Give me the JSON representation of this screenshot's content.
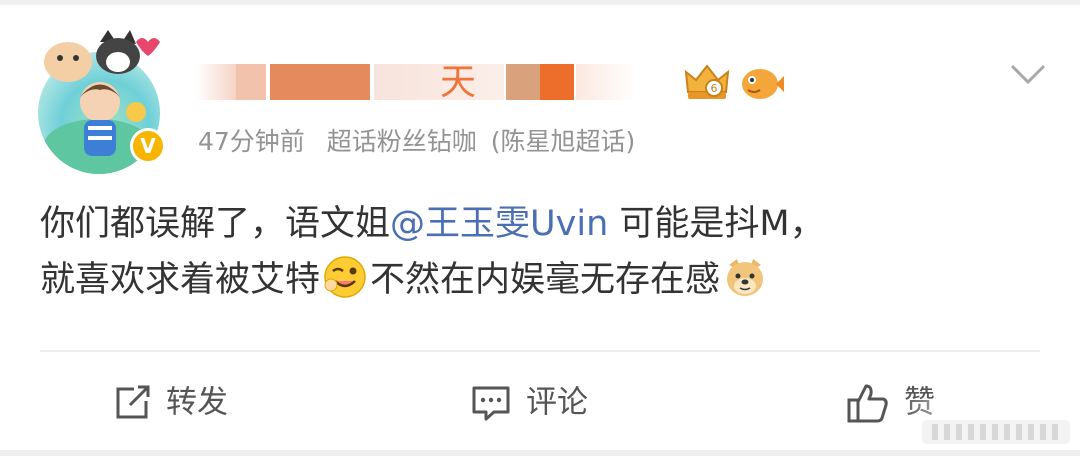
{
  "post": {
    "author": {
      "name_visible_suffix": "天",
      "verified_mark": "V"
    },
    "meta": {
      "time": "47分钟前",
      "source": "超话粉丝钻咖",
      "topic": "(陈星旭超话)"
    },
    "content": {
      "part1": "你们都误解了，语文姐",
      "mention": "@王玉雯Uvin",
      "part2": "可能是抖M，",
      "part3": "就喜欢求着被艾特",
      "emoji1": "wink-emoji",
      "part4": "不然在内娱毫无存在感",
      "emoji2": "doge-emoji"
    },
    "actions": {
      "repost": "转发",
      "comment": "评论",
      "like": "赞"
    }
  },
  "colors": {
    "mention": "#4a6fb5",
    "meta_text": "#939393",
    "name_accent": "#f0743a"
  }
}
